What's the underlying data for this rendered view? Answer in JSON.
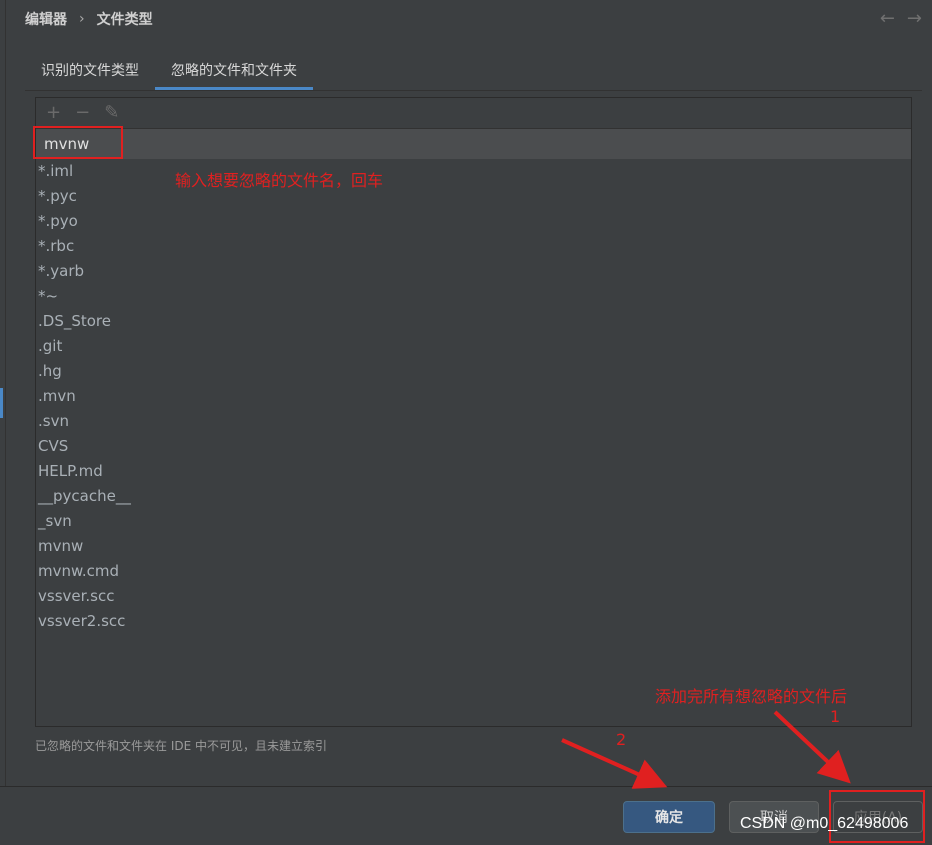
{
  "breadcrumb": {
    "parent": "编辑器",
    "separator": "›",
    "current": "文件类型"
  },
  "nav": {
    "back": "←",
    "forward": "→"
  },
  "tabs": [
    {
      "label": "识别的文件类型",
      "active": false
    },
    {
      "label": "忽略的文件和文件夹",
      "active": true
    }
  ],
  "toolbar": {
    "add": "+",
    "remove": "−",
    "edit": "✎"
  },
  "editing_value": "mvnw",
  "items": [
    "*.iml",
    "*.pyc",
    "*.pyo",
    "*.rbc",
    "*.yarb",
    "*~",
    ".DS_Store",
    ".git",
    ".hg",
    ".mvn",
    ".svn",
    "CVS",
    "HELP.md",
    "__pycache__",
    "_svn",
    "mvnw",
    "mvnw.cmd",
    "vssver.scc",
    "vssver2.scc"
  ],
  "hint": "已忽略的文件和文件夹在 IDE 中不可见，且未建立索引",
  "buttons": {
    "ok": "确定",
    "cancel": "取消",
    "apply": "应用(A)"
  },
  "annotations": {
    "enter_name": "输入想要忽略的文件名，回车",
    "after_adding": "添加完所有想忽略的文件后",
    "step1": "1",
    "step2": "2"
  },
  "watermark": "CSDN @m0_62498006",
  "colors": {
    "accent": "#4a88c7",
    "annotation": "#e02020",
    "primary_button": "#365880"
  }
}
